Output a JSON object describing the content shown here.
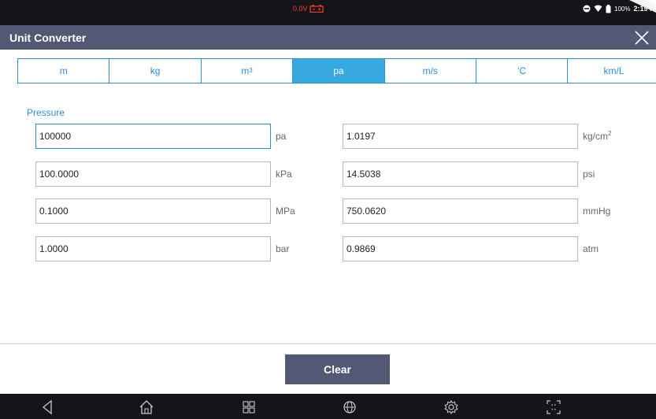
{
  "status_bar": {
    "voltage": "0.0V",
    "battery_percent": "100%",
    "time": "2:19 P"
  },
  "window": {
    "title": "Unit Converter"
  },
  "tabs": [
    {
      "label": "m",
      "sup": "",
      "active": false
    },
    {
      "label": "kg",
      "sup": "",
      "active": false
    },
    {
      "label": "m",
      "sup": "3",
      "active": false
    },
    {
      "label": "pa",
      "sup": "",
      "active": true
    },
    {
      "label": "m/s",
      "sup": "",
      "active": false
    },
    {
      "label": "'C",
      "sup": "",
      "active": false
    },
    {
      "label": "km/L",
      "sup": "",
      "active": false
    }
  ],
  "section": {
    "label": "Pressure"
  },
  "left_fields": [
    {
      "value": "100000",
      "unit": "pa"
    },
    {
      "value": "100.0000",
      "unit": "kPa"
    },
    {
      "value": "0.1000",
      "unit": "MPa"
    },
    {
      "value": "1.0000",
      "unit": "bar"
    }
  ],
  "right_fields": [
    {
      "value": "1.0197",
      "unit": "kg/cm",
      "unit_sup": "2"
    },
    {
      "value": "14.5038",
      "unit": "psi",
      "unit_sup": ""
    },
    {
      "value": "750.0620",
      "unit": "mmHg",
      "unit_sup": ""
    },
    {
      "value": "0.9869",
      "unit": "atm",
      "unit_sup": ""
    }
  ],
  "actions": {
    "clear_label": "Clear"
  },
  "nav_icons": [
    "back-icon",
    "home-icon",
    "recent-apps-icon",
    "globe-icon",
    "settings-gear-icon",
    "screenshot-frame-icon"
  ],
  "colors": {
    "accent": "#2a8fd6",
    "active_tab": "#38a9df",
    "title_bar": "#535875",
    "system_bar": "#141419",
    "battery_warning": "#ff3b30"
  }
}
